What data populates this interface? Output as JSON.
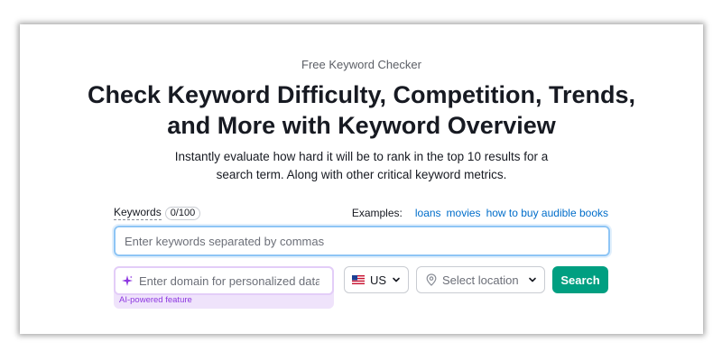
{
  "header": {
    "eyebrow": "Free Keyword Checker",
    "title_line1": "Check Keyword Difficulty, Competition, Trends,",
    "title_line2": "and More with Keyword Overview",
    "subtitle_line1": "Instantly evaluate how hard it will be to rank in the top 10 results for a",
    "subtitle_line2": "search term. Along with other critical keyword metrics."
  },
  "keywords": {
    "label": "Keywords",
    "count": "0/100",
    "placeholder": "Enter keywords separated by commas",
    "value": ""
  },
  "examples": {
    "label": "Examples:",
    "items": [
      "loans",
      "movies",
      "how to buy audible books"
    ]
  },
  "domain": {
    "placeholder": "Enter domain for personalized data",
    "caption": "AI-powered feature",
    "icon": "sparkle-icon"
  },
  "country": {
    "code": "US",
    "flag_icon": "us-flag-icon"
  },
  "location": {
    "placeholder": "Select location",
    "icon": "location-pin-icon"
  },
  "search_button": {
    "label": "Search"
  },
  "colors": {
    "accent": "#009f81",
    "link": "#006dca",
    "ai_purple": "#8d37e0",
    "input_focus": "#8ec5f5"
  }
}
